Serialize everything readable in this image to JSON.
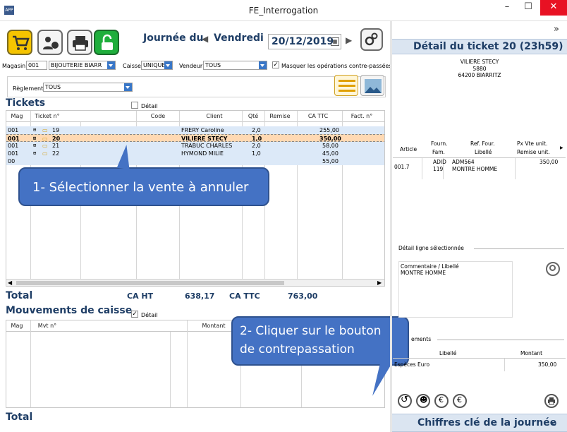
{
  "window": {
    "title": "FE_Interrogation",
    "app_icon": "APP"
  },
  "header": {
    "journee_label": "Journée du",
    "day": "Vendredi",
    "date": "20/12/2019"
  },
  "filters": {
    "magasin_label": "Magasin",
    "magasin_code": "001",
    "magasin_name": "BIJOUTERIE BIARR",
    "caisse_label": "Caisse",
    "caisse_value": "UNIQUE",
    "vendeur_label": "Vendeur",
    "vendeur_value": "TOUS",
    "masquer_label": "Masquer les opérations contre-passées",
    "reglement_label": "Règlement",
    "reglement_value": "TOUS",
    "detail_label": "Détail"
  },
  "tickets": {
    "title": "Tickets",
    "columns": {
      "mag": "Mag",
      "ticket": "Ticket n°",
      "code": "Code",
      "client": "Client",
      "qte": "Qté",
      "remise": "Remise",
      "ca_ttc": "CA TTC",
      "fact": "Fact. n°"
    },
    "rows": [
      {
        "mag": "001",
        "ticket": "19",
        "client": "FRERY Caroline",
        "qte": "2,0",
        "ca": "255,00"
      },
      {
        "mag": "001",
        "ticket": "20",
        "client": "VILIERE STECY",
        "qte": "1,0",
        "ca": "350,00"
      },
      {
        "mag": "001",
        "ticket": "21",
        "client": "TRABUC CHARLES",
        "qte": "2,0",
        "ca": "58,00"
      },
      {
        "mag": "001",
        "ticket": "22",
        "client": "HYMOND MILIE",
        "qte": "1,0",
        "ca": "45,00"
      },
      {
        "mag": "00",
        "ticket": "",
        "client": "",
        "qte": "",
        "ca": "55,00"
      }
    ],
    "total_label": "Total",
    "ca_ht_label": "CA HT",
    "ca_ht": "638,17",
    "ca_ttc_label": "CA TTC",
    "ca_ttc": "763,00"
  },
  "mouvements": {
    "title": "Mouvements de caisse",
    "detail_label": "Détail",
    "columns": {
      "mag": "Mag",
      "mvt": "Mvt n°",
      "montant": "Montant"
    },
    "total_label": "Total"
  },
  "callouts": {
    "step1": "1- Sélectionner la vente à annuler",
    "step2_line1": "2- Cliquer sur le bouton",
    "step2_line2": "de contrepassation"
  },
  "right_panel": {
    "expand_glyph": "»",
    "header": "Détail du ticket 20 (23h59)",
    "client_name": "VILIERE STECY",
    "client_code": "5880",
    "client_city": "64200 BIARRITZ",
    "columns": {
      "article": "Article",
      "fourn": "Fourn.",
      "fam": "Fam.",
      "ref_four": "Ref. Four.",
      "libelle": "Libellé",
      "px_vte": "Px Vte unit.",
      "remise_unit": "Remise unit."
    },
    "article": {
      "code": "001.7",
      "fourn": "ADID",
      "fam": "119",
      "ref": "ADM564",
      "libelle": "MONTRE HOMME",
      "px": "350,00"
    },
    "detail_ligne_label": "Détail ligne sélectionnée",
    "commentaire_label": "Commentaire / Libellé",
    "commentaire_value": "MONTRE HOMME",
    "reglements_label": "ements",
    "reg_col_libelle": "Libellé",
    "reg_col_montant": "Montant",
    "reg_row_libelle": "Espèces Euro",
    "reg_row_montant": "350,00",
    "footer": "Chiffres clé de la journée"
  },
  "colors": {
    "accent": "#1f3e66",
    "selected_row": "#ffd9b3",
    "row_blue": "#dce9f8",
    "callout": "#4472c4"
  }
}
